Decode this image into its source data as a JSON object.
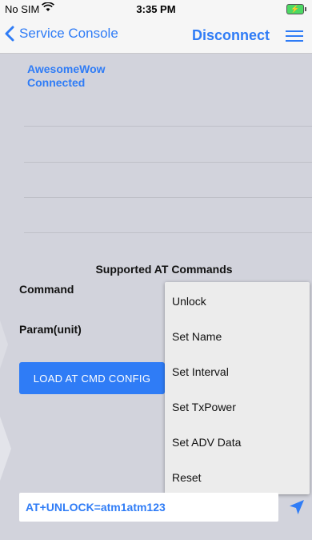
{
  "status_bar": {
    "carrier": "No SIM",
    "time": "3:35 PM",
    "battery": "⚡"
  },
  "nav": {
    "back_label": "Service Console",
    "disconnect_label": "Disconnect"
  },
  "device": {
    "name": "AwesomeWow",
    "status": "Connected"
  },
  "commands": {
    "heading": "Supported AT Commands",
    "command_label": "Command",
    "param_label": "Param(unit)",
    "load_button": "LOAD AT CMD CONFIG"
  },
  "dropdown": {
    "options": [
      "Unlock",
      "Set Name",
      "Set Interval",
      "Set TxPower",
      "Set ADV Data",
      "Reset"
    ]
  },
  "input": {
    "value": "AT+UNLOCK=atm1atm123"
  },
  "colors": {
    "accent": "#2f7cf6",
    "background": "#d2d3dc"
  }
}
